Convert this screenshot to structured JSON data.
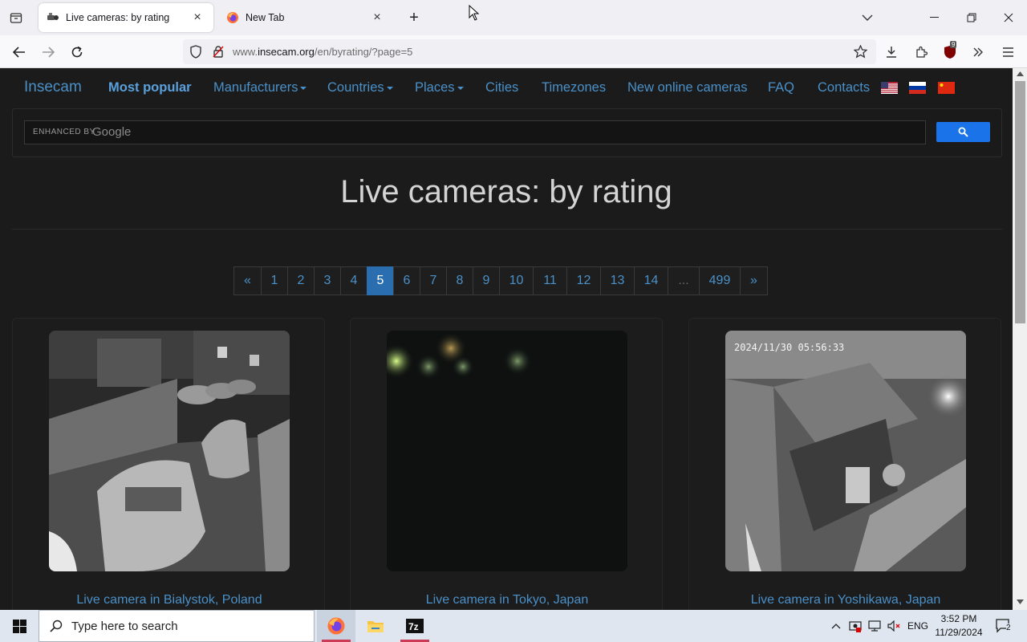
{
  "browser": {
    "tabs": [
      {
        "title": "Live cameras: by rating",
        "active": true
      },
      {
        "title": "New Tab",
        "active": false
      }
    ],
    "url": {
      "prefix": "www.",
      "domain": "insecam.org",
      "path": "/en/byrating/?page=5"
    },
    "extension_badge": "9"
  },
  "site": {
    "nav": {
      "brand": "Insecam",
      "most_popular": "Most popular",
      "manufacturers": "Manufacturers",
      "countries": "Countries",
      "places": "Places",
      "cities": "Cities",
      "timezones": "Timezones",
      "new_cameras": "New online cameras",
      "faq": "FAQ",
      "contacts": "Contacts"
    },
    "search": {
      "enhanced_by": "ENHANCED BY",
      "google": "Google"
    },
    "title": "Live cameras: by rating",
    "pagination": [
      "«",
      "1",
      "2",
      "3",
      "4",
      "5",
      "6",
      "7",
      "8",
      "9",
      "10",
      "11",
      "12",
      "13",
      "14",
      "...",
      "499",
      "»"
    ],
    "current_page": "5",
    "cameras": [
      {
        "caption": "Live camera in Bialystok, Poland"
      },
      {
        "caption": "Live camera in Tokyo, Japan"
      },
      {
        "caption": "Live camera in Yoshikawa, Japan",
        "timestamp": "2024/11/30 05:56:33"
      }
    ]
  },
  "taskbar": {
    "search_placeholder": "Type here to search",
    "language": "ENG",
    "time": "3:52 PM",
    "date": "11/29/2024",
    "notifications": "2"
  }
}
